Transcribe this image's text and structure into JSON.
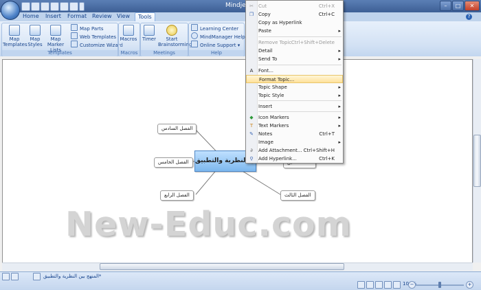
{
  "title": "Mindje",
  "tabs": [
    {
      "label": "Home"
    },
    {
      "label": "Insert"
    },
    {
      "label": "Format"
    },
    {
      "label": "Review"
    },
    {
      "label": "View"
    },
    {
      "label": "Tools"
    }
  ],
  "ribbon": {
    "groups": {
      "templates": "Templates",
      "macros": "Macros",
      "meetings": "Meetings",
      "help": "Help"
    },
    "buttons": {
      "map_templates": "Map Templates",
      "map_styles": "Map Styles",
      "map_marker_lists": "Map Marker Lists",
      "map_parts": "Map Parts",
      "web_templates": "Web Templates",
      "customize_wizard": "Customize Wizard",
      "macros": "Macros",
      "timer": "Timer",
      "start_brainstorming": "Start Brainstorming",
      "learning_center": "Learning Center",
      "mindmanager_help": "MindManager Help",
      "online_support": "Online Support"
    }
  },
  "map": {
    "central_topic": "المنهج بين النظرية والتطبيق",
    "topics": {
      "sixth": "الفصل السادس",
      "fifth": "الفصل الخامس",
      "fourth": "الفصل الرابع",
      "third": "الفصل الثالث",
      "first": "ال"
    }
  },
  "watermark": "New-Educ.com",
  "context_menu": {
    "items": [
      {
        "label": "Cut",
        "shortcut": "Ctrl+X",
        "disabled": true,
        "icon": "scissors-icon"
      },
      {
        "label": "Copy",
        "shortcut": "Ctrl+C",
        "icon": "copy-icon"
      },
      {
        "label": "Copy as Hyperlink"
      },
      {
        "label": "Paste",
        "submenu": true
      },
      {
        "label": "Remove Topic",
        "shortcut": "Ctrl+Shift+Delete",
        "disabled": true
      },
      {
        "label": "Detail",
        "submenu": true
      },
      {
        "label": "Send To",
        "submenu": true
      },
      {
        "label": "Font...",
        "icon": "font-icon"
      },
      {
        "label": "Format Topic...",
        "highlighted": true
      },
      {
        "label": "Topic Shape",
        "submenu": true
      },
      {
        "label": "Topic Style",
        "submenu": true
      },
      {
        "label": "Insert",
        "submenu": true
      },
      {
        "label": "Icon Markers",
        "submenu": true,
        "icon": "icon-markers-icon"
      },
      {
        "label": "Text Markers",
        "submenu": true,
        "icon": "text-markers-icon"
      },
      {
        "label": "Notes",
        "shortcut": "Ctrl+T",
        "icon": "notes-icon"
      },
      {
        "label": "Image",
        "submenu": true
      },
      {
        "label": "Add Attachment...",
        "shortcut": "Ctrl+Shift+H",
        "icon": "paperclip-icon"
      },
      {
        "label": "Add Hyperlink...",
        "shortcut": "Ctrl+K",
        "icon": "link-icon"
      }
    ]
  },
  "status": {
    "document_tab": "المنهج بين النظرية والتطبيق*",
    "zoom": "100%"
  },
  "colors": {
    "accent": "#3d5f95",
    "central_topic": "#7db8ee",
    "menu_highlight": "#ffe19a"
  }
}
